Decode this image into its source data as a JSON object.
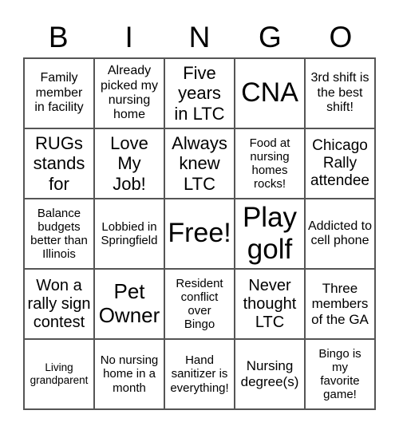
{
  "header": [
    "B",
    "I",
    "N",
    "G",
    "O"
  ],
  "cells": [
    "Family member in facility",
    "Already picked my nursing home",
    "Five years in LTC",
    "CNA",
    "3rd shift is the best shift!",
    "RUGs stands for",
    "Love My Job!",
    "Always knew LTC",
    "Food at nursing homes rocks!",
    "Chicago Rally attendee",
    "Balance budgets better than Illinois",
    "Lobbied in Springfield",
    "Free!",
    "Play golf",
    "Addicted to cell phone",
    "Won a rally sign contest",
    "Pet Owner",
    "Resident conflict over Bingo",
    "Never thought LTC",
    "Three members of the GA",
    "Living grandparent",
    "No nursing home in a month",
    "Hand sanitizer is everything!",
    "Nursing degree(s)",
    "Bingo is my favorite game!"
  ]
}
